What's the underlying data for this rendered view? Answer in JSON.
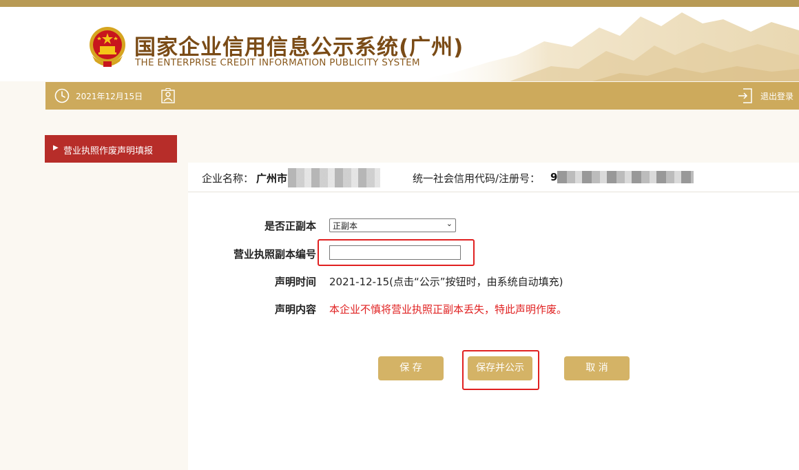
{
  "header": {
    "title_cn": "国家企业信用信息公示系统(广州)",
    "title_en": "THE ENTERPRISE CREDIT INFORMATION PUBLICITY SYSTEM"
  },
  "navbar": {
    "date": "2021年12月15日",
    "logout_label": "退出登录"
  },
  "sidebar": {
    "items": [
      {
        "label": "营业执照作废声明填报",
        "active": true
      }
    ]
  },
  "company": {
    "name_label": "企业名称：",
    "name_value": "广州市",
    "code_label": "统一社会信用代码/注册号：",
    "code_value": "9"
  },
  "form": {
    "copy_type_label": "是否正副本",
    "copy_type_selected": "正副本",
    "license_no_label": "营业执照副本编号",
    "license_no_value": "",
    "declare_time_label": "声明时间",
    "declare_time_value": "2021-12-15(点击“公示”按钮时，由系统自动填充)",
    "declare_content_label": "声明内容",
    "declare_content_value": "本企业不慎将营业执照正副本丢失，特此声明作废。"
  },
  "buttons": {
    "save": "保 存",
    "save_publish": "保存并公示",
    "cancel": "取 消"
  },
  "colors": {
    "accent_gold": "#cdaa5c",
    "button_gold": "#d4b366",
    "sidebar_red": "#b72d29",
    "highlight_red": "#e02020",
    "title_brown": "#7a4b16"
  }
}
